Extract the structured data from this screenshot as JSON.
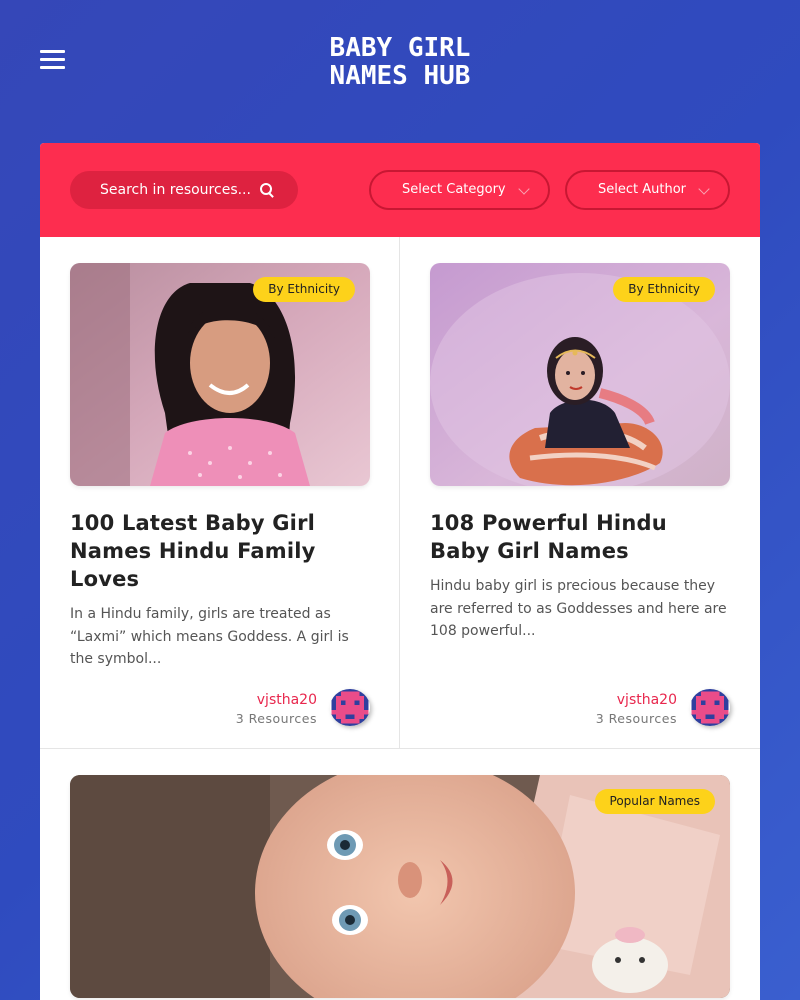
{
  "header": {
    "logo_line1": "BABY GIRL",
    "logo_line2": "NAMES HUB"
  },
  "filters": {
    "search_placeholder": "Search in resources...",
    "category_label": "Select Category",
    "author_label": "Select Author"
  },
  "colors": {
    "background": "#3547b8",
    "filter_bar": "#fd2d4f",
    "badge": "#fdd21a",
    "author_link": "#e8274d"
  },
  "cards": [
    {
      "badge": "By Ethnicity",
      "title": "100 Latest Baby Girl Names Hindu Family Loves",
      "excerpt": "In a Hindu family, girls are treated as “Laxmi” which means Goddess. A girl is the symbol...",
      "author": "vjstha20",
      "resources": "3 Resources"
    },
    {
      "badge": "By Ethnicity",
      "title": "108 Powerful Hindu Baby Girl Names",
      "excerpt": "Hindu baby girl is precious because they are referred to as Goddesses and here are 108 powerful...",
      "author": "vjstha20",
      "resources": "3 Resources"
    },
    {
      "badge": "Popular Names"
    }
  ]
}
